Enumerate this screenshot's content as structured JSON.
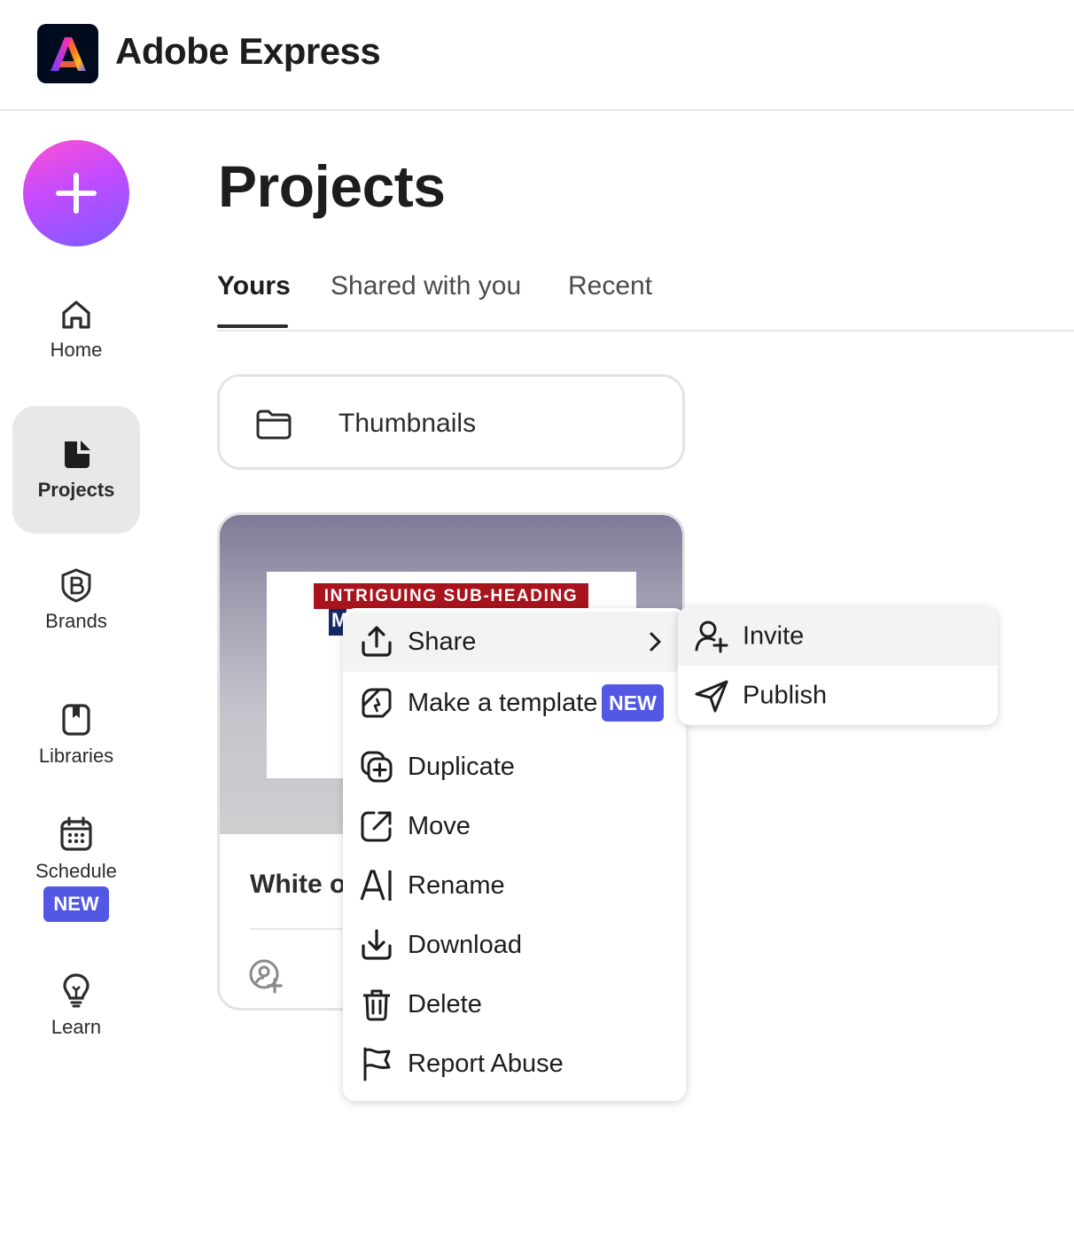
{
  "app": {
    "title": "Adobe Express",
    "logo_icon": "adobe-express-logo"
  },
  "sidebar": {
    "create_icon": "plus-icon",
    "items": [
      {
        "label": "Home",
        "icon": "home-icon",
        "active": false
      },
      {
        "label": "Projects",
        "icon": "projects-icon",
        "active": true
      },
      {
        "label": "Brands",
        "icon": "brands-icon",
        "active": false
      },
      {
        "label": "Libraries",
        "icon": "libraries-icon",
        "active": false
      },
      {
        "label": "Schedule",
        "icon": "calendar-icon",
        "active": false,
        "badge": "NEW"
      },
      {
        "label": "Learn",
        "icon": "lightbulb-icon",
        "active": false
      }
    ]
  },
  "main": {
    "title": "Projects",
    "tabs": [
      {
        "label": "Yours",
        "active": true
      },
      {
        "label": "Shared with you",
        "active": false
      },
      {
        "label": "Recent",
        "active": false
      }
    ],
    "folder": {
      "label": "Thumbnails",
      "icon": "folder-icon"
    },
    "project": {
      "thumbnail_banner": "INTRIGUING SUB-HEADING",
      "thumbnail_heading": "M",
      "name": "White o"
    }
  },
  "context_menu": {
    "items": [
      {
        "label": "Share",
        "icon": "share-icon",
        "has_submenu": true,
        "hovered": true
      },
      {
        "label": "Make a template",
        "icon": "template-icon",
        "badge": "NEW"
      },
      {
        "label": "Duplicate",
        "icon": "duplicate-icon"
      },
      {
        "label": "Move",
        "icon": "move-icon"
      },
      {
        "label": "Rename",
        "icon": "rename-icon"
      },
      {
        "label": "Download",
        "icon": "download-icon"
      },
      {
        "label": "Delete",
        "icon": "trash-icon"
      },
      {
        "label": "Report Abuse",
        "icon": "flag-icon"
      }
    ]
  },
  "submenu": {
    "items": [
      {
        "label": "Invite",
        "icon": "invite-user-icon",
        "hovered": true
      },
      {
        "label": "Publish",
        "icon": "send-icon"
      }
    ]
  },
  "colors": {
    "badge": "#5258e4",
    "create_gradient_start": "#ff4fd2",
    "create_gradient_end": "#7b5cff",
    "active_nav_bg": "#e8e8e8",
    "banner_red": "#a8141d"
  }
}
